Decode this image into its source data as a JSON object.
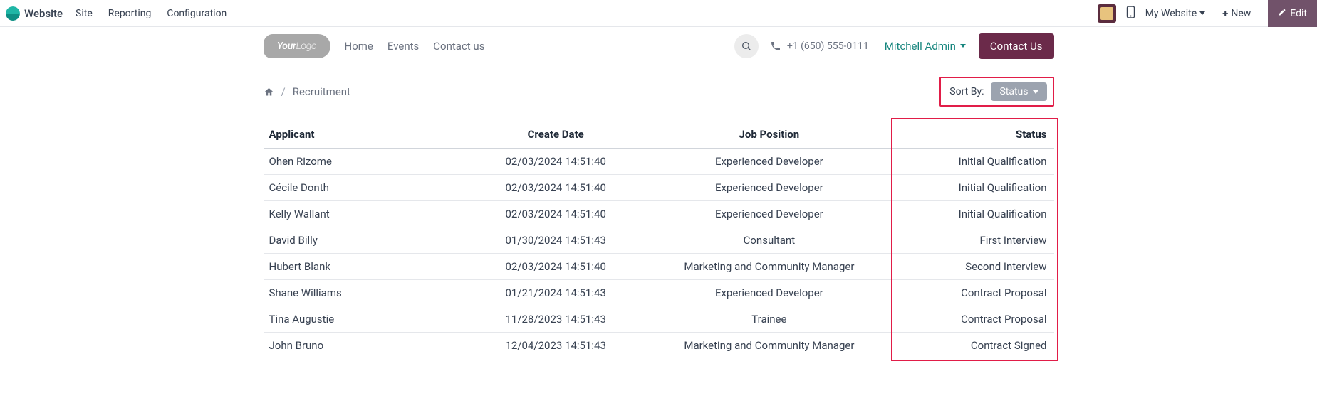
{
  "topbar": {
    "app_name": "Website",
    "menu": [
      "Site",
      "Reporting",
      "Configuration"
    ],
    "my_website": "My Website",
    "new_label": "New",
    "edit_label": "Edit"
  },
  "site_header": {
    "brand_bold": "Your",
    "brand_light": "Logo",
    "nav": [
      "Home",
      "Events",
      "Contact us"
    ],
    "phone": "+1 (650) 555-0111",
    "user": "Mitchell Admin",
    "contact_btn": "Contact Us"
  },
  "breadcrumb": {
    "current": "Recruitment",
    "separator": "/"
  },
  "sort": {
    "label": "Sort By:",
    "value": "Status"
  },
  "table": {
    "headers": {
      "applicant": "Applicant",
      "create_date": "Create Date",
      "position": "Job Position",
      "status": "Status"
    },
    "rows": [
      {
        "applicant": "Ohen Rizome",
        "date": "02/03/2024 14:51:40",
        "position": "Experienced Developer",
        "status": "Initial Qualification"
      },
      {
        "applicant": "Cécile Donth",
        "date": "02/03/2024 14:51:40",
        "position": "Experienced Developer",
        "status": "Initial Qualification"
      },
      {
        "applicant": "Kelly Wallant",
        "date": "02/03/2024 14:51:40",
        "position": "Experienced Developer",
        "status": "Initial Qualification"
      },
      {
        "applicant": "David Billy",
        "date": "01/30/2024 14:51:43",
        "position": "Consultant",
        "status": "First Interview"
      },
      {
        "applicant": "Hubert Blank",
        "date": "02/03/2024 14:51:40",
        "position": "Marketing and Community Manager",
        "status": "Second Interview"
      },
      {
        "applicant": "Shane Williams",
        "date": "01/21/2024 14:51:43",
        "position": "Experienced Developer",
        "status": "Contract Proposal"
      },
      {
        "applicant": "Tina Augustie",
        "date": "11/28/2023 14:51:43",
        "position": "Trainee",
        "status": "Contract Proposal"
      },
      {
        "applicant": "John Bruno",
        "date": "12/04/2023 14:51:43",
        "position": "Marketing and Community Manager",
        "status": "Contract Signed"
      }
    ]
  }
}
